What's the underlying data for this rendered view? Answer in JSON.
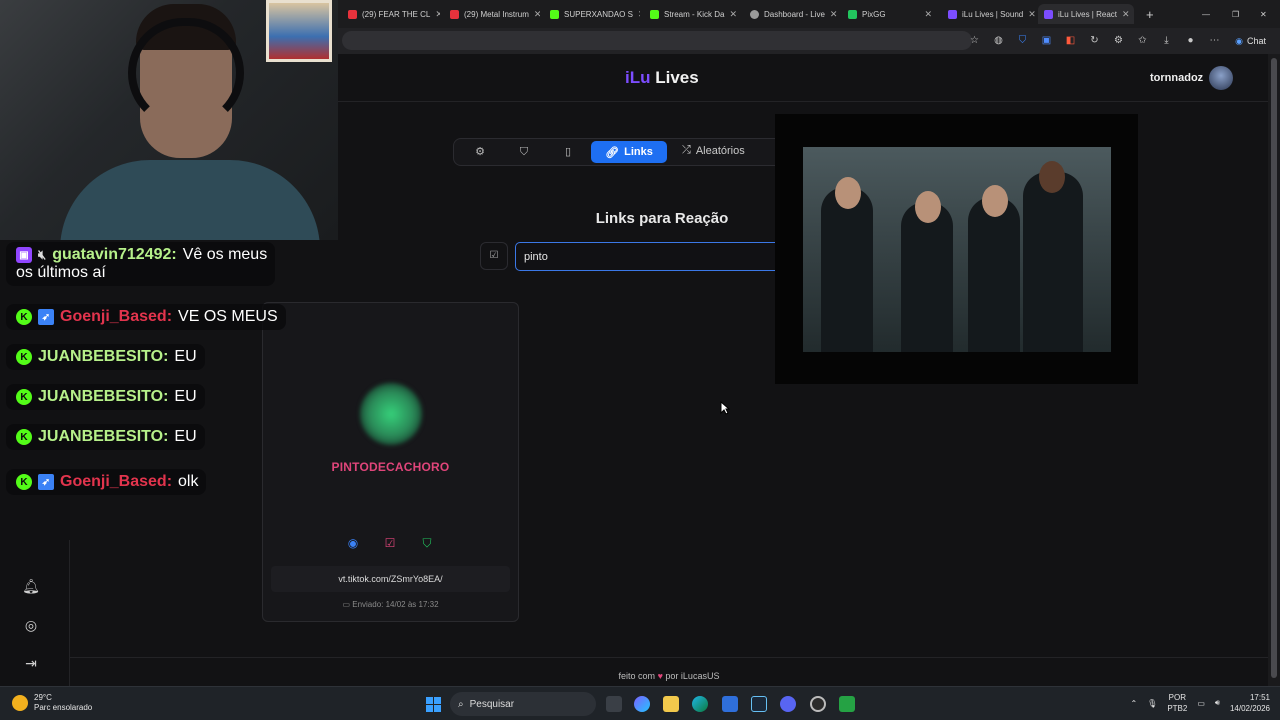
{
  "browser": {
    "tabs": [
      {
        "label": "(29) FEAR THE CL",
        "color": "#e8323c"
      },
      {
        "label": "(29) Metal Instrum",
        "color": "#e8323c"
      },
      {
        "label": "SUPERXANDAO S",
        "color": "#53fc18"
      },
      {
        "label": "Stream - Kick Da",
        "color": "#53fc18"
      },
      {
        "label": "Dashboard - Live",
        "color": "#9a9a9a"
      },
      {
        "label": "PixGG",
        "color": "#22c55e"
      },
      {
        "label": "iLu Lives | Sound",
        "color": "#7c4dff"
      },
      {
        "label": "iLu Lives | React",
        "color": "#7c4dff"
      }
    ],
    "chat_label": "Chat"
  },
  "app": {
    "logo_prefix": "iLu",
    "logo_suffix": " Lives",
    "username": "tornnadoz",
    "accent": "#1e6ff2",
    "brand": "#7c4dff"
  },
  "nav": {
    "links_label": "Links",
    "random_label": "Aleatórios"
  },
  "main": {
    "section_title": "Links para Reação",
    "search_value": "pinto"
  },
  "card": {
    "name": "PINTODECACHORO",
    "link": "vt.tiktok.com/ZSmrYo8EA/",
    "date": "Enviado: 14/02 às 17:32"
  },
  "chat": [
    {
      "user": "guatavin712492:",
      "text": " Vê os meus",
      "text2": "os últimos aí",
      "user_color": "#b6f08a",
      "platform": "twitch"
    },
    {
      "user": "Goenji_Based:",
      "text": " VE OS MEUS",
      "user_color": "#e2344d",
      "platform": "kick"
    },
    {
      "user": "JUANBEBESITO:",
      "text": " EU",
      "user_color": "#b6f08a",
      "platform": "kick"
    },
    {
      "user": "JUANBEBESITO:",
      "text": " EU",
      "user_color": "#b6f08a",
      "platform": "kick"
    },
    {
      "user": "JUANBEBESITO:",
      "text": " EU",
      "user_color": "#b6f08a",
      "platform": "kick"
    },
    {
      "user": "Goenji_Based:",
      "text": " olk",
      "user_color": "#e2344d",
      "platform": "kick"
    }
  ],
  "footer": {
    "prefix": "feito com",
    "suffix": "por iLucasUS"
  },
  "taskbar": {
    "temp": "29°C",
    "weather": "Parc ensolarado",
    "search_placeholder": "Pesquisar",
    "lang1": "POR",
    "lang2": "PTB2",
    "time": "17:51",
    "date": "14/02/2026"
  }
}
